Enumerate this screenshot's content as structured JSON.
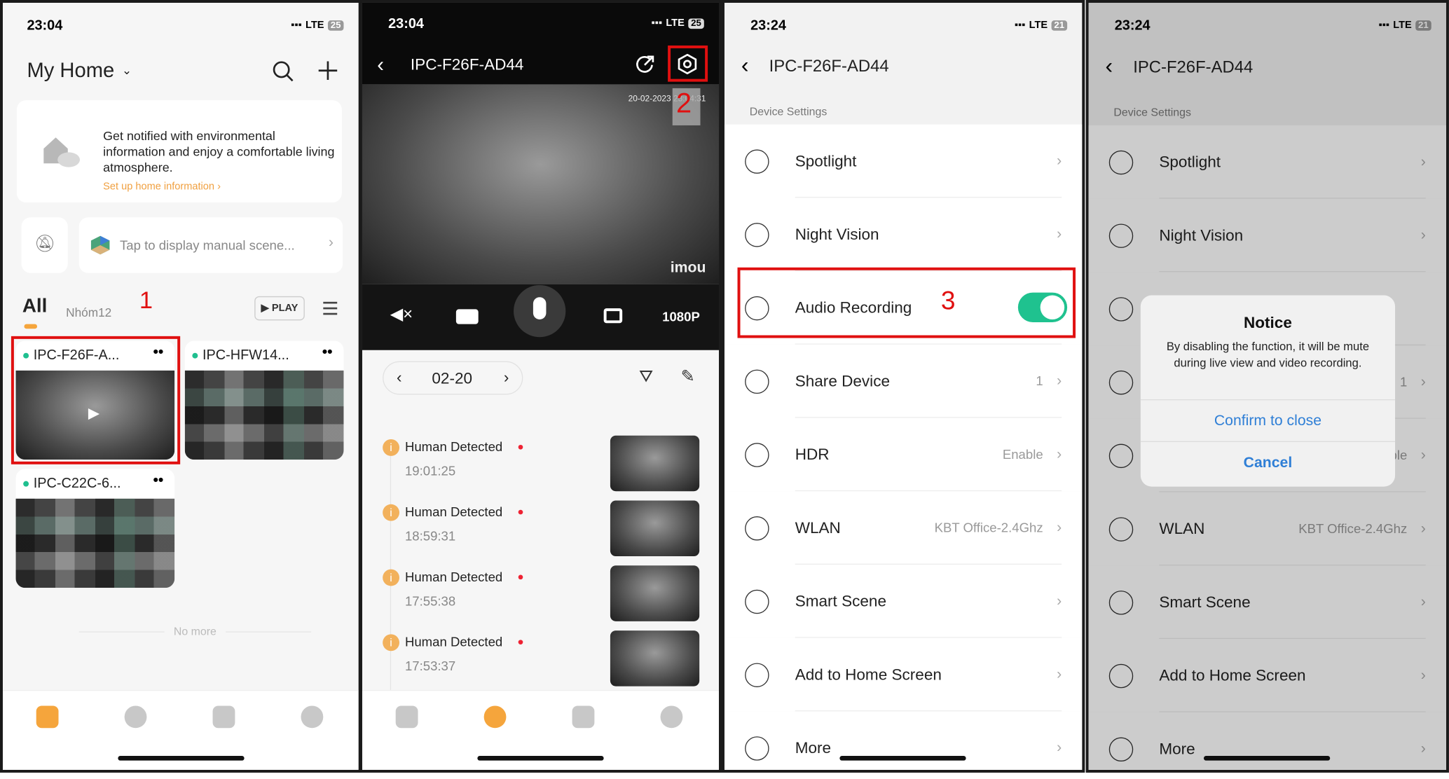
{
  "status": {
    "time_a": "23:04",
    "time_b": "23:24",
    "network": "LTE",
    "battery_a": "25",
    "battery_b": "21"
  },
  "home": {
    "title": "My Home",
    "promo": {
      "text": "Get notified with environmental information and enjoy a comfortable living atmosphere.",
      "link": "Set up home information"
    },
    "scene_prompt": "Tap to display manual scene...",
    "tabs": [
      {
        "label": "All",
        "active": true
      },
      {
        "label": "Nhóm12",
        "active": false
      }
    ],
    "step_marker": "1",
    "play_label": "PLAY",
    "devices": [
      {
        "name": "IPC-F26F-A...",
        "online": true,
        "highlighted": true
      },
      {
        "name": "IPC-HFW14...",
        "online": true
      },
      {
        "name": "IPC-C22C-6...",
        "online": true
      }
    ],
    "no_more": "No more",
    "nav": [
      {
        "icon": "home-icon",
        "active": true
      },
      {
        "icon": "scene-icon"
      },
      {
        "icon": "messages-icon"
      },
      {
        "icon": "profile-icon"
      }
    ]
  },
  "live": {
    "title": "IPC-F26F-AD44",
    "step_marker": "2",
    "overlay_timestamp": "20-02-2023 23:04:31",
    "watermark": "imou",
    "resolution": "1080P",
    "date": "02-20",
    "events": [
      {
        "title": "Human Detected",
        "time": "19:01:25"
      },
      {
        "title": "Human Detected",
        "time": "18:59:31"
      },
      {
        "title": "Human Detected",
        "time": "17:55:38"
      },
      {
        "title": "Human Detected",
        "time": "17:53:37"
      }
    ],
    "nav": [
      {
        "icon": "playback-icon"
      },
      {
        "icon": "messages-icon",
        "active": true
      },
      {
        "icon": "list-icon"
      },
      {
        "icon": "shield-icon"
      }
    ]
  },
  "settings": {
    "title": "IPC-F26F-AD44",
    "section": "Device Settings",
    "step_marker": "3",
    "items": [
      {
        "label": "Spotlight",
        "icon": "spotlight-icon"
      },
      {
        "label": "Night Vision",
        "icon": "night-vision-icon"
      },
      {
        "label": "Audio Recording",
        "icon": "audio-recording-icon",
        "toggle": true
      },
      {
        "label": "Share Device",
        "icon": "share-device-icon",
        "value": "1"
      },
      {
        "label": "HDR",
        "icon": "hdr-icon",
        "value": "Enable"
      },
      {
        "label": "WLAN",
        "icon": "wifi-icon",
        "value": "KBT Office-2.4Ghz"
      },
      {
        "label": "Smart Scene",
        "icon": "smart-scene-icon"
      },
      {
        "label": "Add to Home Screen",
        "icon": "add-home-screen-icon"
      },
      {
        "label": "More",
        "icon": "more-icon"
      }
    ]
  },
  "dialog": {
    "title": "Notice",
    "message": "By disabling the function, it will be mute during live view and video recording.",
    "confirm": "Confirm to close",
    "cancel": "Cancel"
  },
  "colors": {
    "accent": "#f5a53c",
    "toggle_on": "#1fc28f",
    "dialog_link": "#2f7fd6",
    "highlight": "#e01010"
  }
}
